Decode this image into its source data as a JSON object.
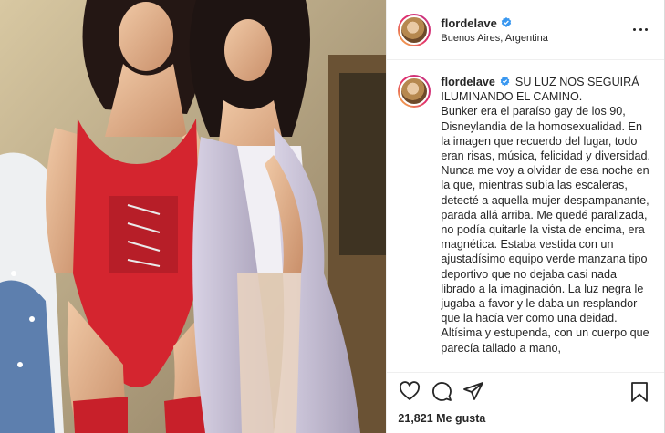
{
  "post": {
    "username": "flordelave",
    "location": "Buenos Aires, Argentina",
    "verified_icon": "verified-badge-icon",
    "accent_color": "#3897f0",
    "caption_headline": "SU LUZ NOS SEGUIRÁ ILUMINANDO EL CAMINO.",
    "caption_text": "Bunker era el paraíso gay de los 90, Disneylandia de la homosexualidad. En la imagen que recuerdo del lugar, todo eran risas, música, felicidad y diversidad. Nunca me voy a olvidar de esa noche en la que, mientras subía las escaleras, detecté a aquella mujer despampanante, parada allá arriba. Me quedé paralizada, no podía quitarle la vista de encima, era magnética. Estaba vestida con un ajustadísimo equipo verde manzana tipo deportivo que no dejaba casi nada librado a la imaginación. La luz negra le jugaba a favor y le daba un resplandor que la hacía ver como una deidad. Altísima y estupenda, con un cuerpo que parecía tallado a mano,",
    "likes": "21,821 Me gusta"
  },
  "icons": {
    "more": "more-options-icon",
    "like": "heart-icon",
    "comment": "comment-icon",
    "share": "share-icon",
    "save": "bookmark-icon"
  }
}
